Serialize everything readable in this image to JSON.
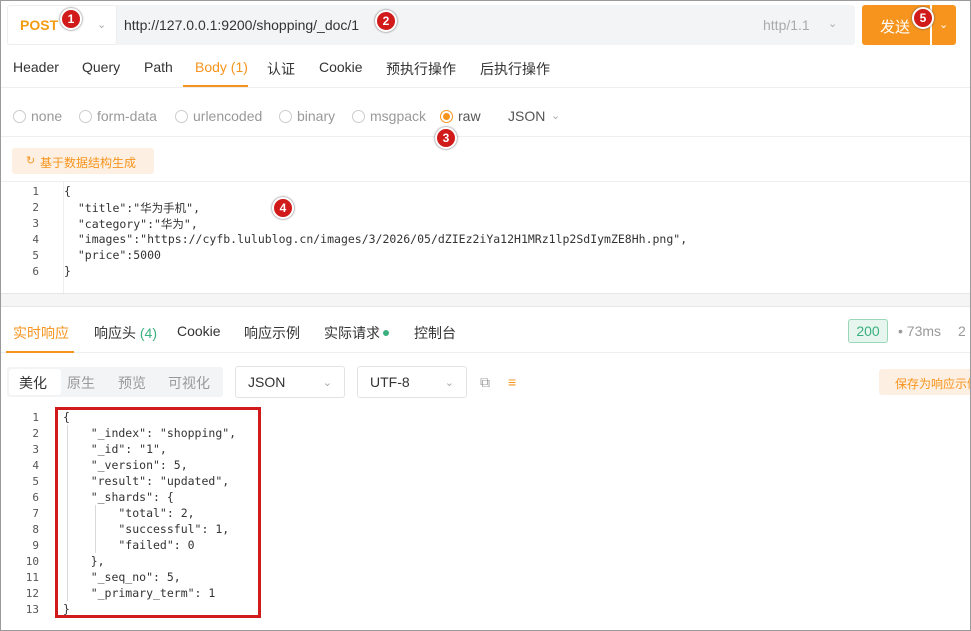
{
  "request": {
    "method": "POST",
    "url": "http://127.0.0.1:9200/shopping/_doc/1",
    "protocol": "http/1.1",
    "send_label": "发送"
  },
  "request_tabs": [
    "Header",
    "Query",
    "Path",
    "Body (1)",
    "认证",
    "Cookie",
    "预执行操作",
    "后执行操作"
  ],
  "body_types": [
    "none",
    "form-data",
    "urlencoded",
    "binary",
    "msgpack",
    "raw"
  ],
  "body_format": "JSON",
  "generate_label": "基于数据结构生成",
  "request_body": {
    "line_numbers": [
      "1",
      "2",
      "3",
      "4",
      "5",
      "6"
    ],
    "lines": [
      "{",
      "  \"title\":\"华为手机\",",
      "  \"category\":\"华为\",",
      "  \"images\":\"https://cyfb.lulublog.cn/images/3/2026/05/dZIEz2iYa12H1MRz1lp2SdIymZE8Hh.png\",",
      "  \"price\":5000",
      "}"
    ]
  },
  "response_tabs": {
    "live": "实时响应",
    "headers": "响应头",
    "headers_count": "(4)",
    "cookie": "Cookie",
    "example": "响应示例",
    "actual": "实际请求",
    "console": "控制台"
  },
  "status_code": "200",
  "time": "73ms",
  "size_partial": "2",
  "view_modes": [
    "美化",
    "原生",
    "预览",
    "可视化"
  ],
  "response_format": "JSON",
  "encoding": "UTF-8",
  "save_label": "保存为响应示例",
  "response_body": {
    "line_numbers": [
      "1",
      "2",
      "3",
      "4",
      "5",
      "6",
      "7",
      "8",
      "9",
      "10",
      "11",
      "12",
      "13"
    ],
    "lines": [
      "{",
      "    \"_index\": \"shopping\",",
      "    \"_id\": \"1\",",
      "    \"_version\": 5,",
      "    \"result\": \"updated\",",
      "    \"_shards\": {",
      "        \"total\": 2,",
      "        \"successful\": 1,",
      "        \"failed\": 0",
      "    },",
      "    \"_seq_no\": 5,",
      "    \"_primary_term\": 1",
      "}"
    ]
  },
  "markers": [
    "1",
    "2",
    "3",
    "4",
    "5"
  ],
  "colors": {
    "accent": "#f7941d",
    "success": "#3ab07e",
    "highlight": "#d11a1a"
  }
}
